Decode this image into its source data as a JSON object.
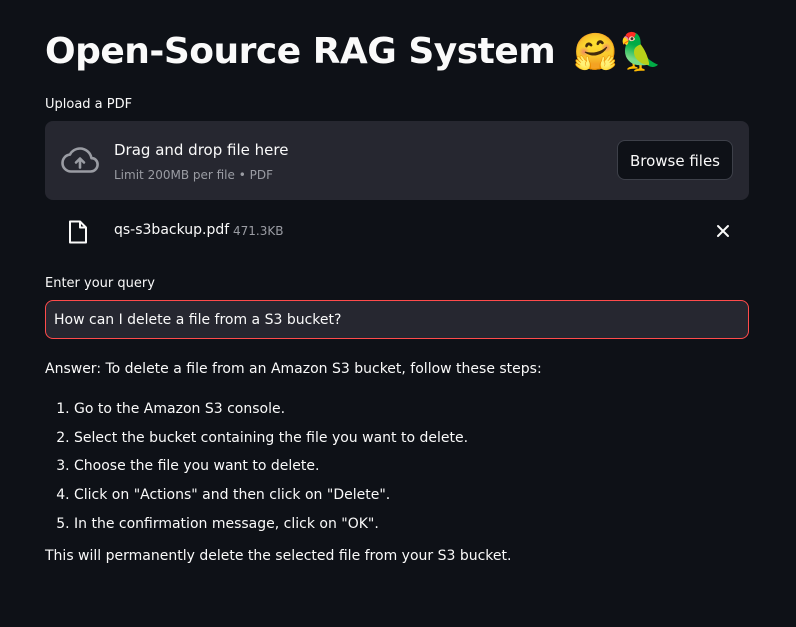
{
  "header": {
    "title": "Open-Source RAG System",
    "emoji": "🤗🦜"
  },
  "uploader": {
    "label": "Upload a PDF",
    "drop_text": "Drag and drop file here",
    "limit_text": "Limit 200MB per file • PDF",
    "browse_label": "Browse files",
    "file": {
      "name": "qs-s3backup.pdf",
      "size": "471.3KB"
    }
  },
  "query": {
    "label": "Enter your query",
    "value": "How can I delete a file from a S3 bucket?"
  },
  "answer": {
    "intro": "Answer: To delete a file from an Amazon S3 bucket, follow these steps:",
    "steps": [
      "Go to the Amazon S3 console.",
      "Select the bucket containing the file you want to delete.",
      "Choose the file you want to delete.",
      "Click on \"Actions\" and then click on \"Delete\".",
      "In the confirmation message, click on \"OK\"."
    ],
    "outro": "This will permanently delete the selected file from your S3 bucket."
  },
  "colors": {
    "background": "#0e1117",
    "panel": "#262730",
    "accent": "#ff4b4b",
    "muted_text": "#9a9ca3"
  },
  "icons": {
    "upload": "cloud-upload-icon",
    "file": "file-icon",
    "close": "close-icon"
  }
}
